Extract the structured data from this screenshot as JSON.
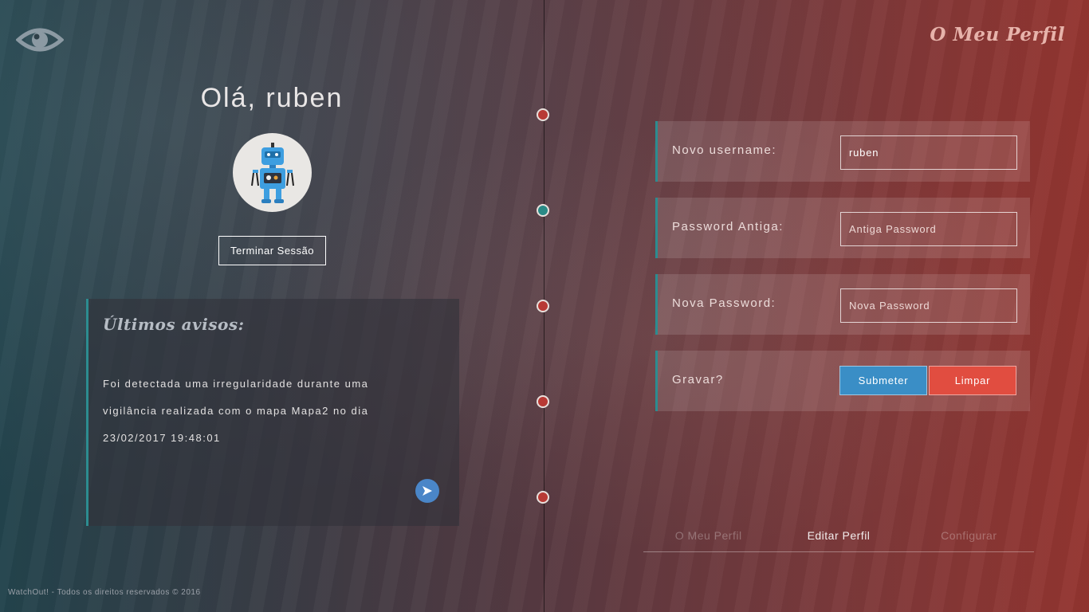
{
  "header": {
    "logo_icon": "eye-icon",
    "brand_title": "O Meu Perfil"
  },
  "profile": {
    "greeting": "Olá, ruben",
    "avatar_icon": "robot-avatar",
    "logout_label": "Terminar Sessão"
  },
  "notices": {
    "title": "Últimos avisos:",
    "message": "Foi detectada uma irregularidade durante uma vigilância realizada com o mapa Mapa2 no dia 23/02/2017 19:48:01",
    "arrow_icon": "arrow-right-icon"
  },
  "timeline": {
    "dots": [
      {
        "color": "#b83a35"
      },
      {
        "color": "#2a8a86"
      },
      {
        "color": "#b83a35"
      },
      {
        "color": "#b83a35"
      },
      {
        "color": "#b83a35"
      }
    ]
  },
  "form": {
    "username": {
      "label": "Novo username:",
      "value": "ruben",
      "placeholder": ""
    },
    "old_password": {
      "label": "Password Antiga:",
      "value": "",
      "placeholder": "Antiga Password"
    },
    "new_password": {
      "label": "Nova Password:",
      "value": "",
      "placeholder": "Nova Password"
    },
    "save": {
      "label": "Gravar?",
      "submit_label": "Submeter",
      "clear_label": "Limpar"
    }
  },
  "tabs": [
    {
      "label": "O Meu Perfil",
      "active": false
    },
    {
      "label": "Editar Perfil",
      "active": true
    },
    {
      "label": "Configurar",
      "active": false
    }
  ],
  "footer": {
    "text": "WatchOut! - Todos os direitos reservados © 2016"
  },
  "colors": {
    "accent_teal": "#2c8c90",
    "submit_blue": "#3a8ec6",
    "clear_red": "#e14d40"
  }
}
